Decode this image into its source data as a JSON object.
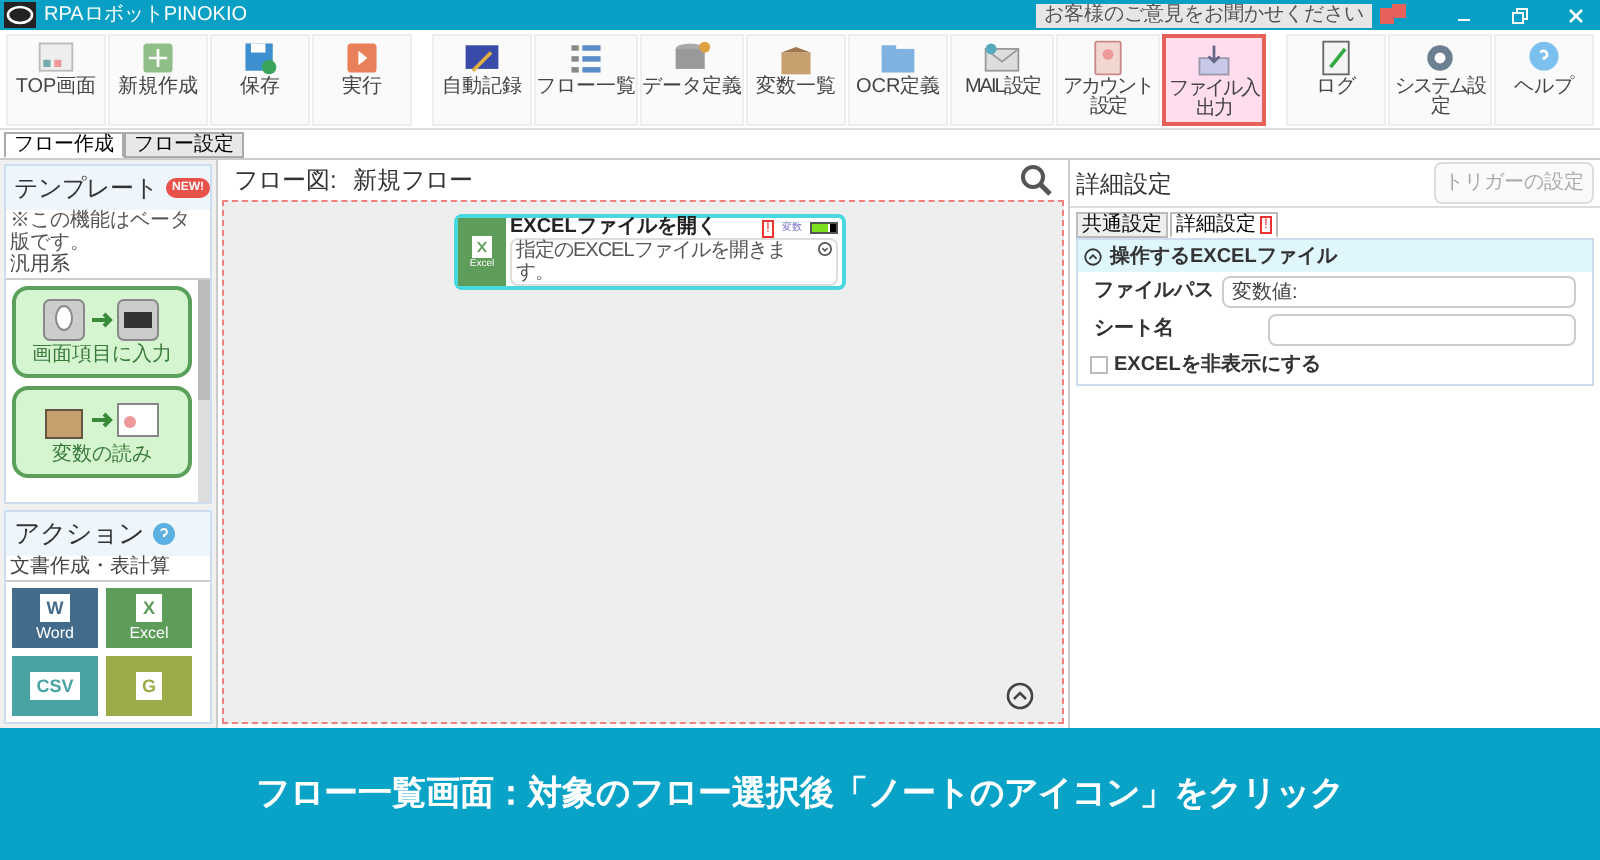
{
  "window": {
    "title": "RPAロボットPINOKIO",
    "feedback": "お客様のご意見をお聞かせください"
  },
  "toolbar": [
    {
      "label": "TOP画面",
      "highlighted": false
    },
    {
      "label": "新規作成",
      "highlighted": false
    },
    {
      "label": "保存",
      "highlighted": false
    },
    {
      "label": "実行",
      "highlighted": false
    },
    {
      "label": "自動記録",
      "highlighted": false
    },
    {
      "label": "フロー一覧",
      "highlighted": false
    },
    {
      "label": "データ定義",
      "highlighted": false
    },
    {
      "label": "変数一覧",
      "highlighted": false
    },
    {
      "label": "OCR定義",
      "highlighted": false
    },
    {
      "label": "MAIL設定",
      "highlighted": false
    },
    {
      "label": "アカウント設定",
      "highlighted": false
    },
    {
      "label": "ファイル入出力",
      "highlighted": true
    },
    {
      "label": "ログ",
      "highlighted": false
    },
    {
      "label": "システム設定",
      "highlighted": false
    },
    {
      "label": "ヘルプ",
      "highlighted": false
    }
  ],
  "tabs": [
    {
      "label": "フロー作成",
      "selected": true
    },
    {
      "label": "フロー設定",
      "selected": false
    }
  ],
  "templates": {
    "title": "テンプレート",
    "badge": "NEW!",
    "note": "※この機能はベータ版です。",
    "category": "汎用系",
    "cards": [
      {
        "label": "画面項目に入力"
      },
      {
        "label": "変数の読み"
      }
    ]
  },
  "actions": {
    "title": "アクション",
    "category": "文書作成・表計算",
    "items": [
      {
        "label": "Word",
        "letter": "W",
        "color": "#436b8c"
      },
      {
        "label": "Excel",
        "letter": "X",
        "color": "#5d9c59"
      },
      {
        "letter": "CSV",
        "color": "#4aa3a3"
      },
      {
        "letter": "G",
        "color": "#9aab4a"
      }
    ]
  },
  "flow": {
    "title": "フロー図:",
    "name": "新規フロー",
    "node": {
      "title": "EXCELファイルを開く",
      "icon_label": "Excel",
      "warning": "!",
      "tag": "変数",
      "description": "指定のEXCELファイルを開きます。"
    }
  },
  "details": {
    "title": "詳細設定",
    "trigger_button": "トリガーの設定",
    "tabs": [
      {
        "label": "共通設定",
        "selected": false
      },
      {
        "label": "詳細設定",
        "selected": true,
        "warning": "!"
      }
    ],
    "section": "操作するEXCELファイル",
    "fields": [
      {
        "label": "ファイルパス",
        "value": "変数値:"
      },
      {
        "label": "シート名"
      }
    ],
    "checkbox": {
      "label": "EXCELを非表示にする",
      "checked": false
    }
  },
  "caption": "フロー一覧画面：対象のフロー選択後「ノートのアイコン」をクリック"
}
